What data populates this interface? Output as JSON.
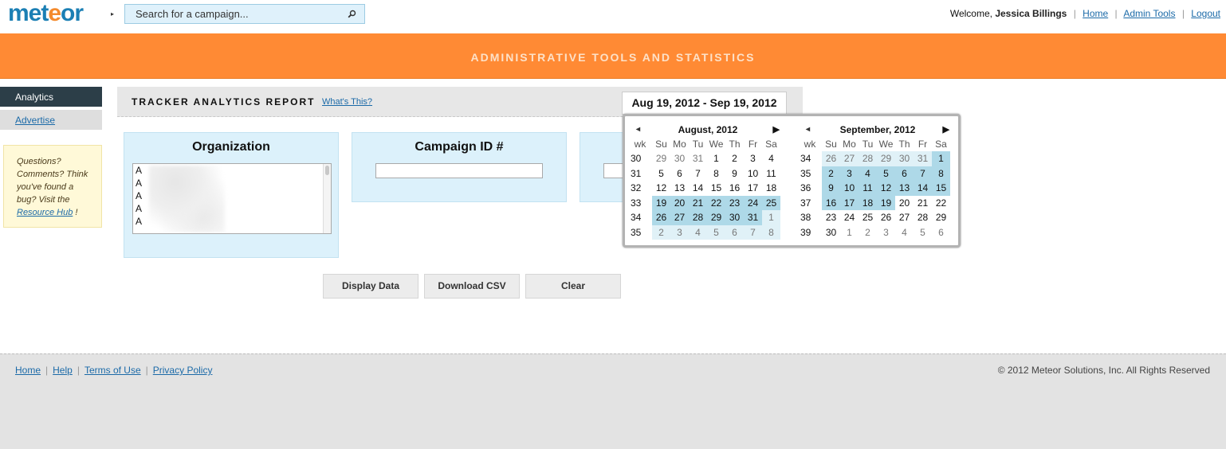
{
  "header": {
    "logo_part1": "met",
    "logo_part2": "e",
    "logo_part3": "or",
    "search_placeholder": "Search for a campaign...",
    "welcome": "Welcome,",
    "user_name": "Jessica Billings",
    "links": [
      "Home",
      "Admin Tools",
      "Logout"
    ]
  },
  "banner": {
    "title": "ADMINISTRATIVE TOOLS AND STATISTICS"
  },
  "sidebar": {
    "active": "Analytics",
    "advertise": "Advertise",
    "help_text": "Questions? Comments? Think you've found a bug? Visit the",
    "help_link": "Resource Hub",
    "help_suffix": " !"
  },
  "report": {
    "title": "TRACKER ANALYTICS REPORT",
    "whats_this": "What's This?",
    "date_range": "Aug 19, 2012 - Sep 19, 2012"
  },
  "filters": {
    "organization_title": "Organization",
    "organization_items": [
      "A",
      "A",
      "A",
      "A",
      "A"
    ],
    "campaign_title": "Campaign ID #",
    "campaign_value": ""
  },
  "buttons": {
    "display": "Display Data",
    "csv": "Download CSV",
    "clear": "Clear"
  },
  "calendar": {
    "prev_symbol": "◂",
    "next_symbol": "▶",
    "dow": [
      "wk",
      "Su",
      "Mo",
      "Tu",
      "We",
      "Th",
      "Fr",
      "Sa"
    ],
    "months": [
      {
        "title": "August, 2012",
        "weeks": [
          {
            "wk": "30",
            "days": [
              "29",
              "30",
              "31",
              "1",
              "2",
              "3",
              "4"
            ],
            "other": [
              true,
              true,
              true,
              false,
              false,
              false,
              false
            ],
            "range": [
              false,
              false,
              false,
              false,
              false,
              false,
              false
            ]
          },
          {
            "wk": "31",
            "days": [
              "5",
              "6",
              "7",
              "8",
              "9",
              "10",
              "11"
            ],
            "other": [
              false,
              false,
              false,
              false,
              false,
              false,
              false
            ],
            "range": [
              false,
              false,
              false,
              false,
              false,
              false,
              false
            ]
          },
          {
            "wk": "32",
            "days": [
              "12",
              "13",
              "14",
              "15",
              "16",
              "17",
              "18"
            ],
            "other": [
              false,
              false,
              false,
              false,
              false,
              false,
              false
            ],
            "range": [
              false,
              false,
              false,
              false,
              false,
              false,
              false
            ]
          },
          {
            "wk": "33",
            "days": [
              "19",
              "20",
              "21",
              "22",
              "23",
              "24",
              "25"
            ],
            "other": [
              false,
              false,
              false,
              false,
              false,
              false,
              false
            ],
            "range": [
              true,
              true,
              true,
              true,
              true,
              true,
              true
            ]
          },
          {
            "wk": "34",
            "days": [
              "26",
              "27",
              "28",
              "29",
              "30",
              "31",
              "1"
            ],
            "other": [
              false,
              false,
              false,
              false,
              false,
              false,
              true
            ],
            "range": [
              true,
              true,
              true,
              true,
              true,
              true,
              "light"
            ]
          },
          {
            "wk": "35",
            "days": [
              "2",
              "3",
              "4",
              "5",
              "6",
              "7",
              "8"
            ],
            "other": [
              true,
              true,
              true,
              true,
              true,
              true,
              true
            ],
            "range": [
              "light",
              "light",
              "light",
              "light",
              "light",
              "light",
              "light"
            ]
          }
        ]
      },
      {
        "title": "September, 2012",
        "weeks": [
          {
            "wk": "34",
            "days": [
              "26",
              "27",
              "28",
              "29",
              "30",
              "31",
              "1"
            ],
            "other": [
              true,
              true,
              true,
              true,
              true,
              true,
              false
            ],
            "range": [
              "light",
              "light",
              "light",
              "light",
              "light",
              "light",
              true
            ]
          },
          {
            "wk": "35",
            "days": [
              "2",
              "3",
              "4",
              "5",
              "6",
              "7",
              "8"
            ],
            "other": [
              false,
              false,
              false,
              false,
              false,
              false,
              false
            ],
            "range": [
              true,
              true,
              true,
              true,
              true,
              true,
              true
            ]
          },
          {
            "wk": "36",
            "days": [
              "9",
              "10",
              "11",
              "12",
              "13",
              "14",
              "15"
            ],
            "other": [
              false,
              false,
              false,
              false,
              false,
              false,
              false
            ],
            "range": [
              true,
              true,
              true,
              true,
              true,
              true,
              true
            ]
          },
          {
            "wk": "37",
            "days": [
              "16",
              "17",
              "18",
              "19",
              "20",
              "21",
              "22"
            ],
            "other": [
              false,
              false,
              false,
              false,
              false,
              false,
              false
            ],
            "range": [
              true,
              true,
              true,
              true,
              false,
              false,
              false
            ]
          },
          {
            "wk": "38",
            "days": [
              "23",
              "24",
              "25",
              "26",
              "27",
              "28",
              "29"
            ],
            "other": [
              false,
              false,
              false,
              false,
              false,
              false,
              false
            ],
            "range": [
              false,
              false,
              false,
              false,
              false,
              false,
              false
            ]
          },
          {
            "wk": "39",
            "days": [
              "30",
              "1",
              "2",
              "3",
              "4",
              "5",
              "6"
            ],
            "other": [
              false,
              true,
              true,
              true,
              true,
              true,
              true
            ],
            "range": [
              false,
              false,
              false,
              false,
              false,
              false,
              false
            ]
          }
        ]
      }
    ]
  },
  "footer": {
    "links": [
      "Home",
      "Help",
      "Terms of Use",
      "Privacy Policy"
    ],
    "copyright": "© 2012 Meteor Solutions, Inc. All Rights Reserved"
  }
}
